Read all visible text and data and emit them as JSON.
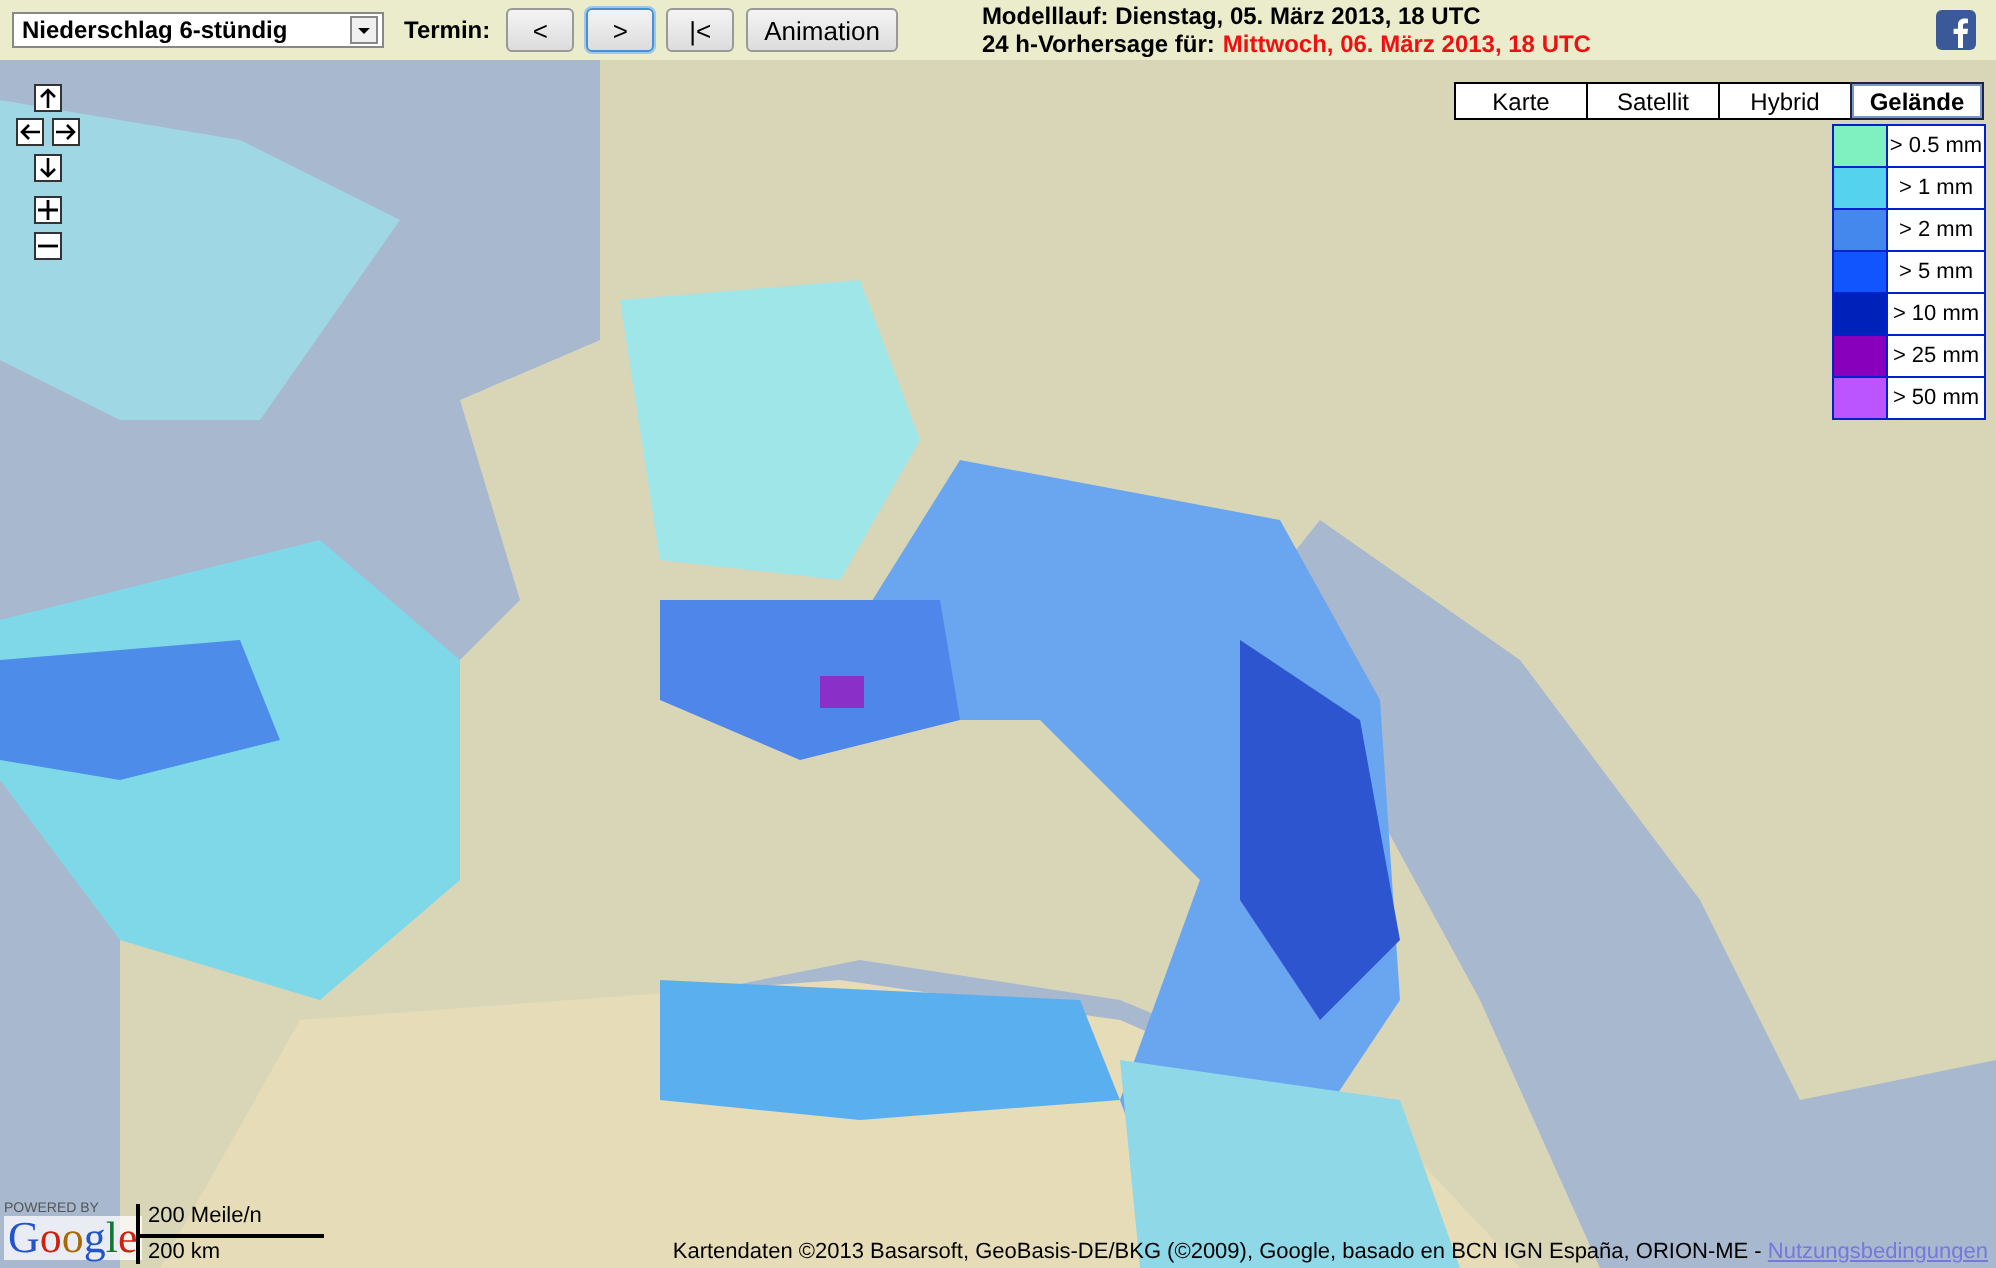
{
  "toolbar": {
    "product_select": {
      "value": "Niederschlag 6-stündig"
    },
    "termin_label": "Termin:",
    "buttons": [
      {
        "label": "<",
        "selected": false
      },
      {
        "label": ">",
        "selected": true
      },
      {
        "label": "|<",
        "selected": false
      },
      {
        "label": "Animation",
        "selected": false
      }
    ],
    "model_run": "Modelllauf: Dienstag, 05. März 2013, 18 UTC",
    "forecast_label": "24 h-Vorhersage für:",
    "forecast_time": "Mittwoch, 06. März 2013, 18 UTC"
  },
  "map": {
    "map_types": [
      {
        "label": "Karte",
        "selected": false
      },
      {
        "label": "Satellit",
        "selected": false
      },
      {
        "label": "Hybrid",
        "selected": false
      },
      {
        "label": "Gelände",
        "selected": true
      }
    ],
    "legend": [
      {
        "label": "> 0.5 mm",
        "color": "#7ff0c0"
      },
      {
        "label": "> 1 mm",
        "color": "#55d2ee"
      },
      {
        "label": "> 2 mm",
        "color": "#4488ee"
      },
      {
        "label": "> 5 mm",
        "color": "#1155ff"
      },
      {
        "label": "> 10 mm",
        "color": "#0022bb"
      },
      {
        "label": "> 25 mm",
        "color": "#8800bb"
      },
      {
        "label": "> 50 mm",
        "color": "#bb55ff"
      }
    ],
    "powered_by": "POWERED BY",
    "logo": "Google",
    "scale_miles": "200 Meile/n",
    "scale_km": "200 km",
    "attribution": "Kartendaten ©2013 Basarsoft, GeoBasis-DE/BKG (©2009), Google, basado en BCN IGN España, ORION-ME - ",
    "terms_link": "Nutzungsbedingungen"
  }
}
